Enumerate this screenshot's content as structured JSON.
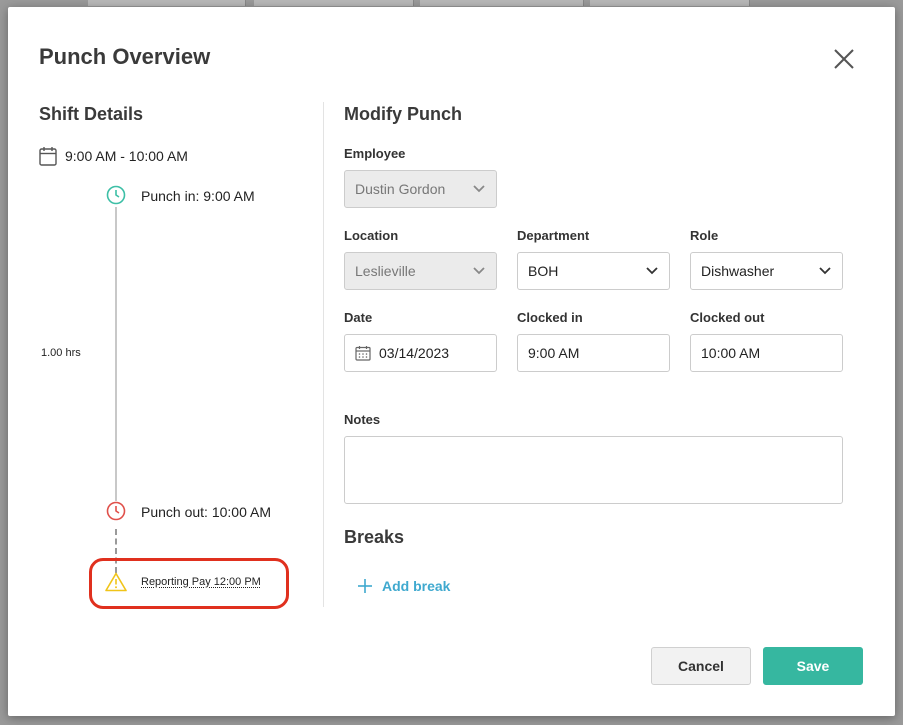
{
  "modal": {
    "title": "Punch Overview",
    "close_icon": "close-icon"
  },
  "shift_details": {
    "title": "Shift Details",
    "range": "9:00 AM - 10:00 AM",
    "punch_in": "Punch in: 9:00 AM",
    "duration": "1.00 hrs",
    "punch_out": "Punch out: 10:00 AM",
    "warning": "Reporting Pay 12:00 PM",
    "colors": {
      "punch_in": "#3dbfa6",
      "punch_out": "#e0504a",
      "warning": "#f0c419",
      "highlight": "#e0301e"
    }
  },
  "modify": {
    "title": "Modify Punch",
    "employee": {
      "label": "Employee",
      "value": "Dustin Gordon"
    },
    "location": {
      "label": "Location",
      "value": "Leslieville"
    },
    "department": {
      "label": "Department",
      "value": "BOH"
    },
    "role": {
      "label": "Role",
      "value": "Dishwasher"
    },
    "date": {
      "label": "Date",
      "value": "03/14/2023"
    },
    "clocked_in": {
      "label": "Clocked in",
      "value": "9:00 AM"
    },
    "clocked_out": {
      "label": "Clocked out",
      "value": "10:00 AM"
    },
    "notes": {
      "label": "Notes",
      "value": ""
    }
  },
  "breaks": {
    "title": "Breaks",
    "add_label": "Add break"
  },
  "actions": {
    "cancel": "Cancel",
    "save": "Save"
  }
}
